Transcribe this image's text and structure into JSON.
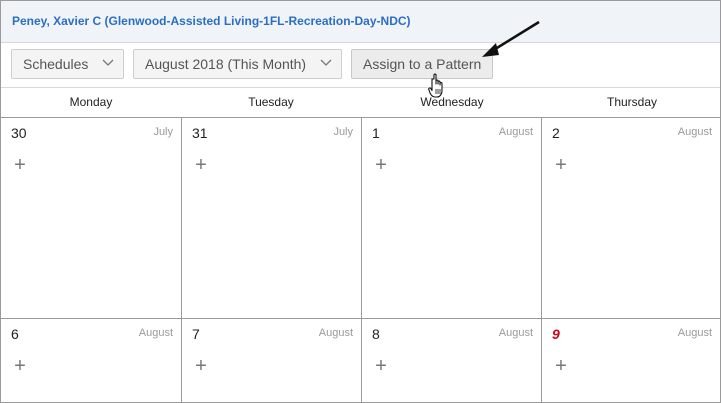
{
  "header": {
    "title": "Peney, Xavier C (Glenwood-Assisted Living-1FL-Recreation-Day-NDC)"
  },
  "toolbar": {
    "schedules_label": "Schedules",
    "month_label": "August 2018 (This Month)",
    "assign_label": "Assign to a Pattern"
  },
  "calendar": {
    "days": [
      "Monday",
      "Tuesday",
      "Wednesday",
      "Thursday"
    ],
    "week1": [
      {
        "day": "30",
        "month": "July",
        "add": "+"
      },
      {
        "day": "31",
        "month": "July",
        "add": "+"
      },
      {
        "day": "1",
        "month": "August",
        "add": "+"
      },
      {
        "day": "2",
        "month": "August",
        "add": "+"
      }
    ],
    "week2": [
      {
        "day": "6",
        "month": "August",
        "add": "+"
      },
      {
        "day": "7",
        "month": "August",
        "add": "+"
      },
      {
        "day": "8",
        "month": "August",
        "add": "+"
      },
      {
        "day": "9",
        "month": "August",
        "add": "+"
      }
    ]
  },
  "colors": {
    "title": "#2a6fc4",
    "today": "#d0021b",
    "border": "#9a9a9a"
  },
  "icons": {
    "dropdown": "chevron-down-icon",
    "add": "plus-icon",
    "pointer": "hand-cursor-icon",
    "annotation": "arrow-icon"
  }
}
